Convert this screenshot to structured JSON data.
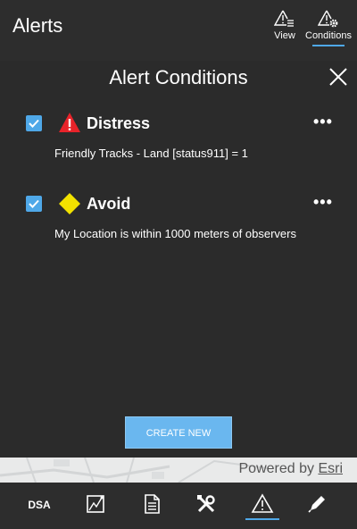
{
  "header": {
    "title": "Alerts",
    "view_label": "View",
    "conditions_label": "Conditions"
  },
  "panel": {
    "title": "Alert Conditions"
  },
  "alerts": [
    {
      "name": "Distress",
      "description": "Friendly Tracks - Land [status911] =  1",
      "checked": true,
      "icon": "warning-triangle-icon",
      "icon_color": "#e8232a"
    },
    {
      "name": "Avoid",
      "description": "My Location is within 1000 meters of observers",
      "checked": true,
      "icon": "yellow-diamond-icon",
      "icon_color": "#f2e200"
    }
  ],
  "more_label": "•••",
  "create_button": "CREATE NEW",
  "attribution": {
    "prefix": "Powered by ",
    "brand": "Esri"
  },
  "toolbar": {
    "dsa_label": "DSA",
    "items": [
      "dsa",
      "map-tool-icon",
      "document-icon",
      "tools-icon",
      "alerts-icon",
      "pencil-icon"
    ],
    "active": "alerts-icon"
  },
  "colors": {
    "accent": "#4fa8e8",
    "background": "#2b2b2b",
    "button": "#6ab7ef"
  }
}
